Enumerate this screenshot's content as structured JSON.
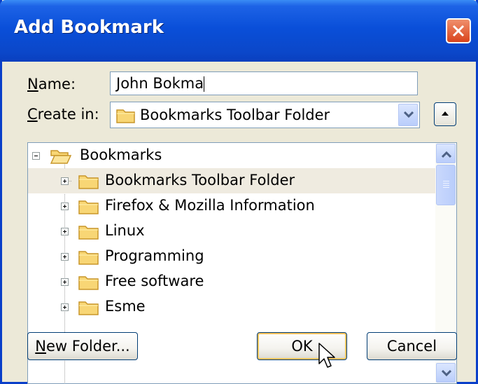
{
  "window": {
    "title": "Add Bookmark"
  },
  "name": {
    "label": "Name:",
    "value": "John Bokma"
  },
  "create_in": {
    "label": "Create in:",
    "selected": "Bookmarks Toolbar Folder"
  },
  "tree": {
    "root": "Bookmarks",
    "items": [
      {
        "label": "Bookmarks Toolbar Folder",
        "selected": true
      },
      {
        "label": "Firefox & Mozilla Information"
      },
      {
        "label": "Linux"
      },
      {
        "label": "Programming"
      },
      {
        "label": "Free software"
      },
      {
        "label": "Esme"
      }
    ]
  },
  "buttons": {
    "new_folder": "New Folder...",
    "ok": "OK",
    "cancel": "Cancel"
  },
  "colors": {
    "titlebar": "#0a4fd9",
    "dialog": "#ece9d8",
    "folder": "#f8d675",
    "default_button_ring": "#f6c35c"
  }
}
